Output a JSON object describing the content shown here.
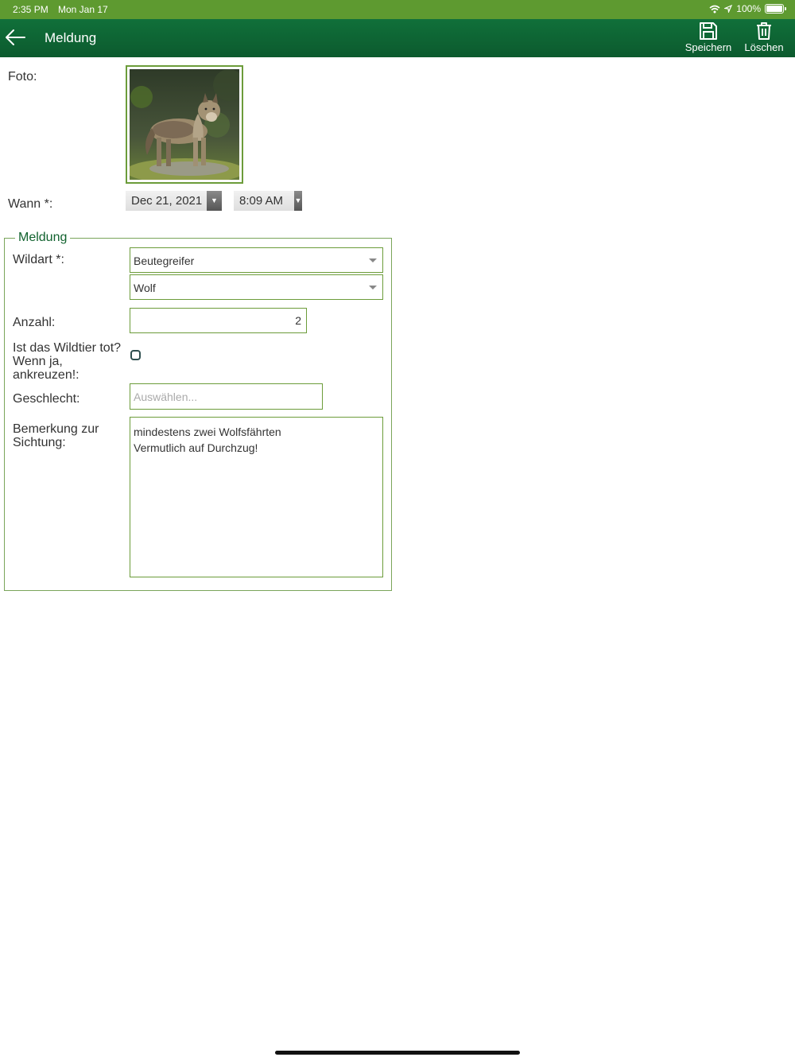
{
  "status_bar": {
    "time": "2:35 PM",
    "date": "Mon Jan 17",
    "battery": "100%",
    "icons": [
      "wifi-icon",
      "location-icon",
      "battery-icon"
    ]
  },
  "nav": {
    "title": "Meldung",
    "back_icon": "arrow-left-icon",
    "save_label": "Speichern",
    "save_icon": "floppy-disk-icon",
    "delete_label": "Löschen",
    "delete_icon": "trash-icon"
  },
  "form": {
    "photo_label": "Foto:",
    "photo_subject": "wolf-photo",
    "when_label": "Wann *:",
    "date_value": "Dec 21, 2021",
    "time_value": "8:09 AM",
    "group_legend": "Meldung",
    "wildart_label": "Wildart *:",
    "wildart_category": "Beutegreifer",
    "wildart_species": "Wolf",
    "anzahl_label": "Anzahl:",
    "anzahl_value": "2",
    "dead_label_line1": "Ist das Wildtier tot?",
    "dead_label_line2": "Wenn ja,",
    "dead_label_line3": "ankreuzen!:",
    "dead_checked": false,
    "geschlecht_label": "Geschlecht:",
    "geschlecht_placeholder": "Auswählen...",
    "bemerkung_label_line1": "Bemerkung zur",
    "bemerkung_label_line2": "Sichtung:",
    "bemerkung_line1": "mindestens zwei Wolfsfährten",
    "bemerkung_line2": "Vermutlich auf Durchzug!"
  },
  "colors": {
    "status_bar": "#5e9a30",
    "nav_bar": "#0c5a2e",
    "field_border": "#6c9c3a",
    "legend_text": "#11622e"
  }
}
